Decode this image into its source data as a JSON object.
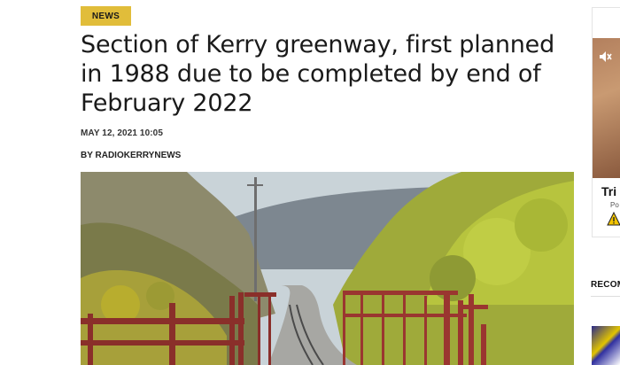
{
  "article": {
    "category": "NEWS",
    "title": "Section of Kerry greenway, first planned in 1988 due to be completed by end of February 2022",
    "date": "MAY 12, 2021 10:05",
    "byline_prefix": "BY",
    "author": "RADIOKERRYNEWS"
  },
  "sidebar": {
    "ad_headline": "Tri",
    "ad_sub": "Po",
    "recommended_label": "RECOM"
  },
  "colors": {
    "badge": "#e1bd3a",
    "text": "#1a1a1a"
  },
  "icons": {
    "mute": "speaker-muted-icon",
    "warning": "warning-icon"
  }
}
